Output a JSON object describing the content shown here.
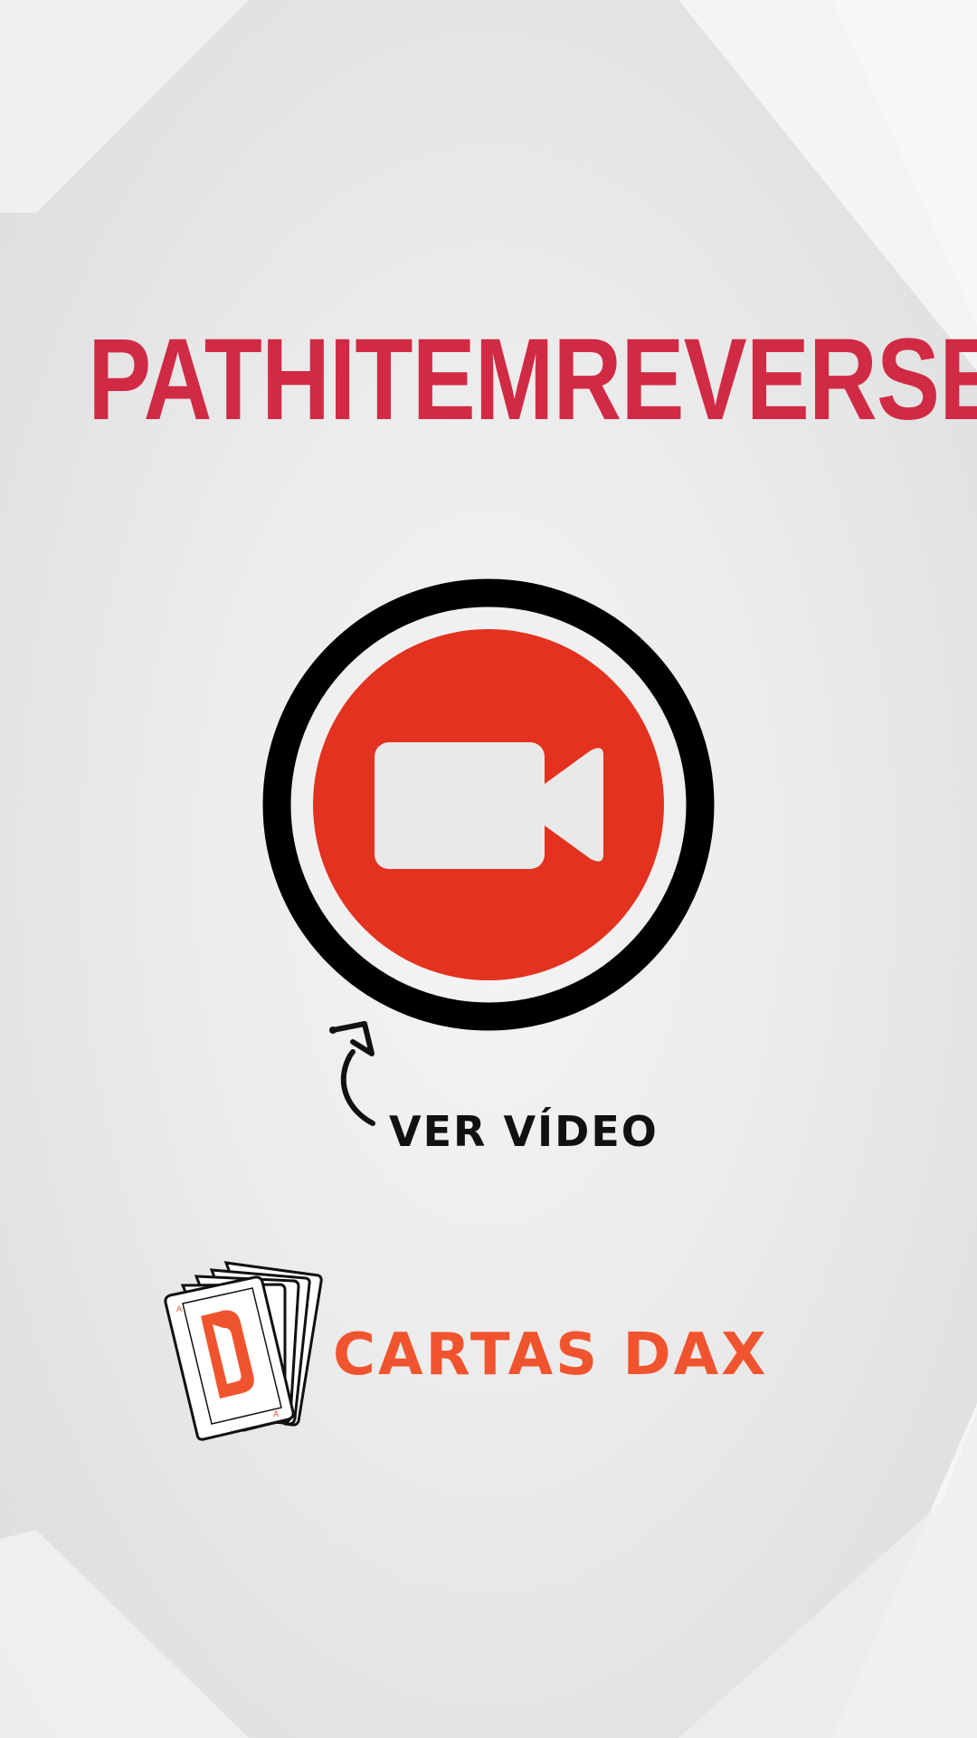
{
  "title": {
    "text": "PATHITEMREVERSE",
    "color": "#d12a44"
  },
  "video_button": {
    "icon": "video-camera-icon",
    "ring_color": "#000000",
    "fill_color": "#e3321f",
    "icon_color": "#e9e9e9"
  },
  "cta": {
    "label": "VER VÍDEO",
    "icon": "curved-arrow-icon"
  },
  "brand": {
    "name": "CARTAS DAX",
    "color": "#f0542e",
    "logo_icon": "playing-cards-logo"
  }
}
